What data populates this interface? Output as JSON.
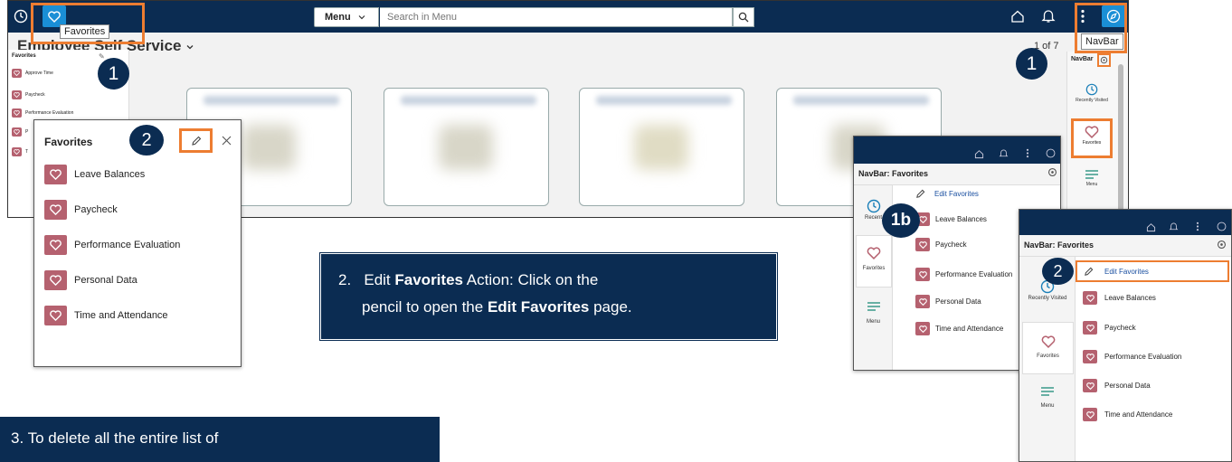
{
  "topbar": {
    "menu_label": "Menu",
    "search_placeholder": "Search in Menu",
    "tooltip_favorites": "Favorites",
    "tooltip_navbar": "NavBar"
  },
  "page": {
    "title_partial": "Employee Self Service",
    "pager": "1 of 7"
  },
  "left_panel": {
    "title": "Favorites",
    "items": [
      "Approve Time",
      "Paycheck",
      "Performance Evaluation",
      "P",
      "T"
    ]
  },
  "fav_popup": {
    "title": "Favorites",
    "items": [
      "Leave Balances",
      "Paycheck",
      "Performance Evaluation",
      "Personal Data",
      "Time and Attendance"
    ]
  },
  "navbar_rail": {
    "label": "NavBar",
    "recently_visited": "Recently Visited",
    "favorites": "Favorites",
    "menu": "Menu"
  },
  "navbar_panel_1": {
    "title": "NavBar: Favorites",
    "edit": "Edit Favorites",
    "rail_recent": "Recent",
    "rail_favorites": "Favorites",
    "rail_menu": "Menu",
    "items": [
      "Leave Balances",
      "Paycheck",
      "Performance Evaluation",
      "Personal Data",
      "Time and Attendance"
    ]
  },
  "navbar_panel_2": {
    "title": "NavBar: Favorites",
    "edit": "Edit Favorites",
    "rail_recent": "Recently Visited",
    "rail_favorites": "Favorites",
    "rail_menu": "Menu",
    "items": [
      "Leave Balances",
      "Paycheck",
      "Performance Evaluation",
      "Personal Data",
      "Time and Attendance"
    ]
  },
  "badges": {
    "b1a": "1",
    "b1b": "1",
    "b2a": "2",
    "b1c": "1b",
    "b2b": "2"
  },
  "callout2": {
    "num": "2.",
    "text_a": "Edit ",
    "bold_a": "Favorites",
    "text_b": " Action: Click on the",
    "text_c": "pencil to open the ",
    "bold_b": "Edit Favorites",
    "text_d": " page."
  },
  "callout3": {
    "text": "3. To delete all the entire list of"
  },
  "colors": {
    "navy": "#0b2c52",
    "heart": "#b5616f",
    "accent_orange": "#ed7d31",
    "blue_button": "#1a8fd6"
  },
  "icons": [
    "clock-icon",
    "heart-icon",
    "chevron-down-icon",
    "search-icon",
    "home-icon",
    "bell-icon",
    "kebab-icon",
    "compass-icon",
    "pencil-icon",
    "close-icon",
    "gear-icon",
    "hamburger-icon"
  ]
}
